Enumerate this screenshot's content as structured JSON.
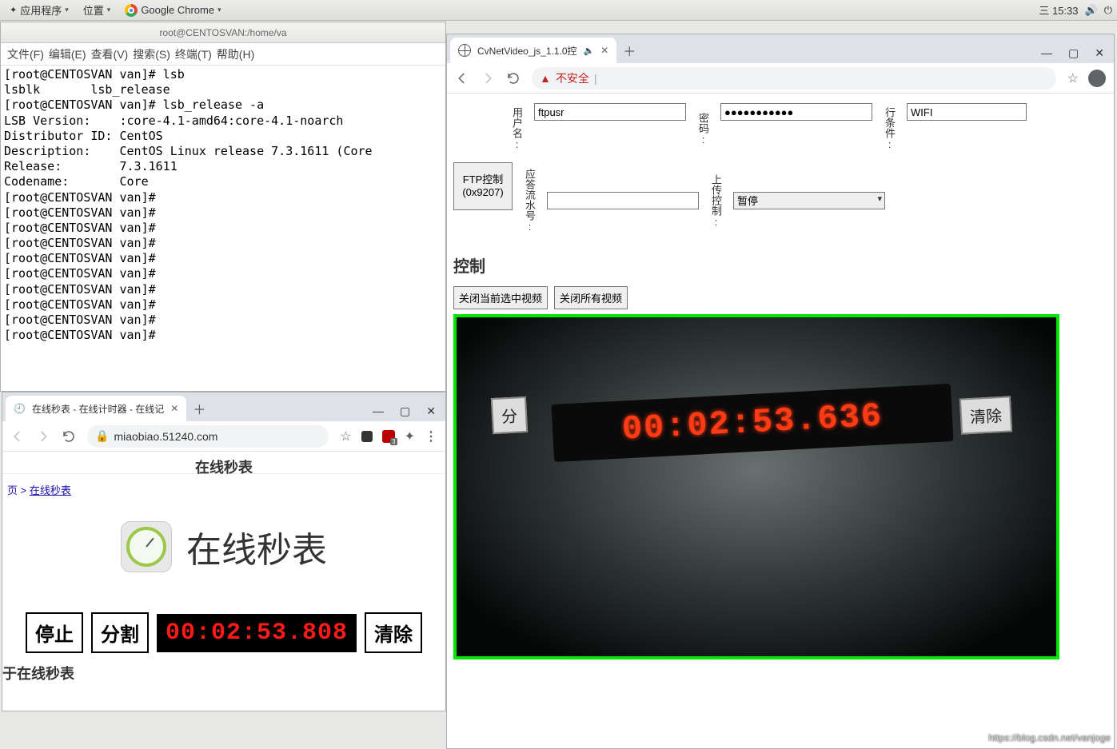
{
  "panel": {
    "apps": "应用程序",
    "places": "位置",
    "chrome": "Google Chrome",
    "time": "三 15:33"
  },
  "terminal": {
    "title": "root@CENTOSVAN:/home/va",
    "menus": [
      "文件(F)",
      "编辑(E)",
      "查看(V)",
      "搜索(S)",
      "终端(T)",
      "帮助(H)"
    ],
    "body": "[root@CENTOSVAN van]# lsb\nlsblk       lsb_release\n[root@CENTOSVAN van]# lsb_release -a\nLSB Version:    :core-4.1-amd64:core-4.1-noarch\nDistributor ID: CentOS\nDescription:    CentOS Linux release 7.3.1611 (Core\nRelease:        7.3.1611\nCodename:       Core\n[root@CENTOSVAN van]#\n[root@CENTOSVAN van]#\n[root@CENTOSVAN van]#\n[root@CENTOSVAN van]#\n[root@CENTOSVAN van]#\n[root@CENTOSVAN van]#\n[root@CENTOSVAN van]#\n[root@CENTOSVAN van]#\n[root@CENTOSVAN van]#\n[root@CENTOSVAN van]#"
  },
  "chrome_right": {
    "tab_title": "CvNetVideo_js_1.1.0控",
    "insecure": "不安全",
    "form": {
      "user_label": "用户名:",
      "user_value": "ftpusr",
      "pwd_label": "密码:",
      "pwd_value": "●●●●●●●●●●●",
      "cond_label": "行条件:",
      "cond_value": "WIFI",
      "ftp_btn": "FTP控制 (0x9207)",
      "resp_label": "应答流水号:",
      "resp_value": "",
      "upload_label": "上传控制:",
      "upload_value": "暂停"
    },
    "ctrl_heading": "控制",
    "btn_close_sel": "关闭当前选中视频",
    "btn_close_all": "关闭所有视频",
    "video_timer": "00:02:53.636",
    "video_clear": "清除"
  },
  "chrome_left": {
    "tab_title": "在线秒表 - 在线计时器 - 在线记",
    "url": "miaobiao.51240.com",
    "page_heading": "在线秒表",
    "breadcrumb_link": "在线秒表",
    "hero_title": "在线秒表",
    "btn_stop": "停止",
    "btn_split": "分割",
    "timer": "00:02:53.808",
    "btn_clear": "清除",
    "footer": "于在线秒表"
  },
  "watermark": "https://blog.csdn.net/vanjoge"
}
